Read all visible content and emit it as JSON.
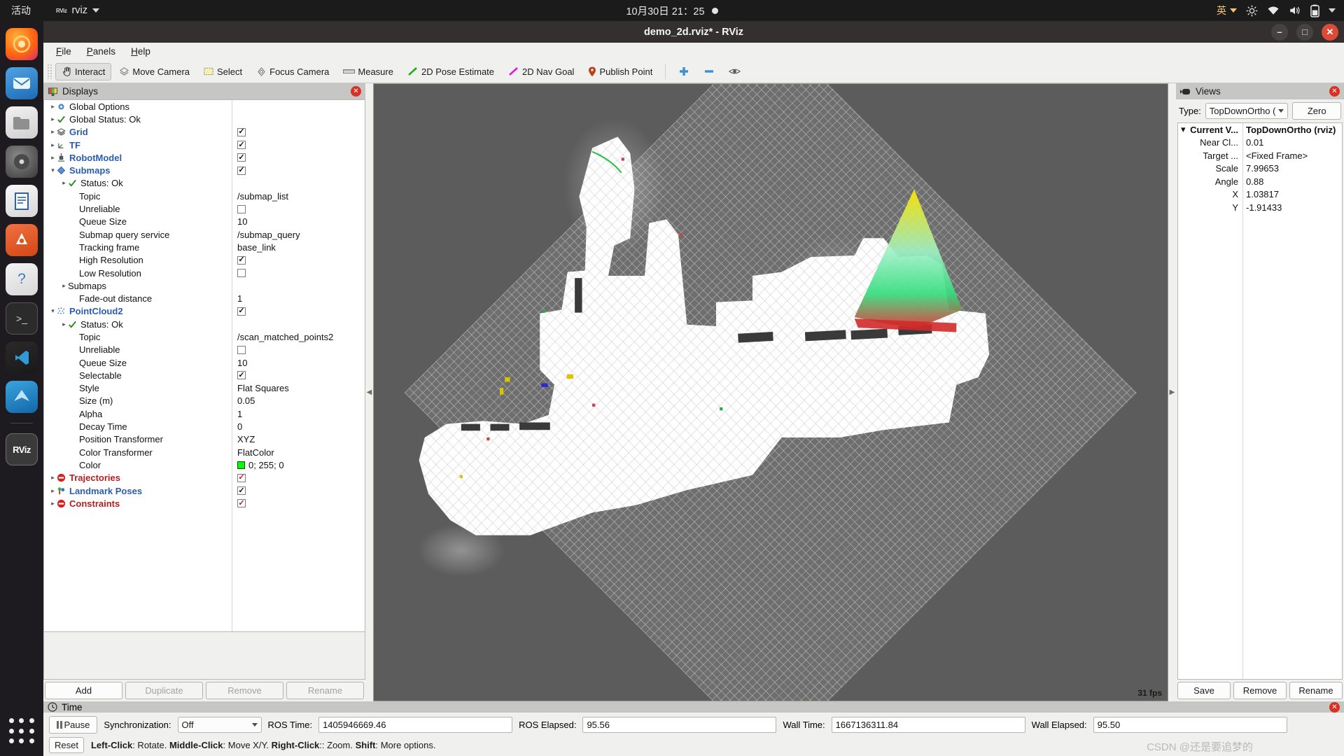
{
  "gnome": {
    "activities": "活动",
    "app_name": "rviz",
    "app_icon": "rviz-icon",
    "clock": "10月30日  21：25",
    "record_indicator": "record-dot",
    "ime": "英",
    "icons": [
      "brightness-icon",
      "wifi-icon",
      "volume-icon",
      "battery-icon",
      "chevron-down-icon"
    ]
  },
  "dock": {
    "items": [
      {
        "name": "firefox",
        "glyph": "●"
      },
      {
        "name": "thunderbird",
        "glyph": "✉"
      },
      {
        "name": "files",
        "glyph": "▰"
      },
      {
        "name": "rhythmbox",
        "glyph": "◉"
      },
      {
        "name": "libreoffice-writer",
        "glyph": "▤"
      },
      {
        "name": "ubuntu-software",
        "glyph": "A"
      },
      {
        "name": "help",
        "glyph": "?"
      },
      {
        "name": "terminal",
        "glyph": ">_"
      },
      {
        "name": "vscode",
        "glyph": "⬢"
      },
      {
        "name": "origami",
        "glyph": "◢"
      },
      {
        "name": "rviz",
        "glyph": "RViz"
      }
    ],
    "show_apps": "show-applications"
  },
  "window": {
    "title": "demo_2d.rviz* - RViz",
    "minimize": "–",
    "maximize": "□",
    "close": "✕"
  },
  "menubar": [
    {
      "label": "File",
      "mnemonic": "F"
    },
    {
      "label": "Panels",
      "mnemonic": "P"
    },
    {
      "label": "Help",
      "mnemonic": "H"
    }
  ],
  "toolbar": {
    "items": [
      {
        "label": "Interact",
        "icon": "hand-cursor-icon",
        "active": true
      },
      {
        "label": "Move Camera",
        "icon": "move-camera-icon",
        "active": false
      },
      {
        "label": "Select",
        "icon": "select-rect-icon",
        "active": false
      },
      {
        "label": "Focus Camera",
        "icon": "focus-camera-icon",
        "active": false
      },
      {
        "label": "Measure",
        "icon": "ruler-icon",
        "active": false
      },
      {
        "label": "2D Pose Estimate",
        "icon": "pose-arrow-green-icon",
        "active": false
      },
      {
        "label": "2D Nav Goal",
        "icon": "nav-arrow-magenta-icon",
        "active": false
      },
      {
        "label": "Publish Point",
        "icon": "map-pin-icon",
        "active": false
      }
    ],
    "extra_icons": [
      "plus-icon",
      "minus-icon",
      "eye-icon"
    ]
  },
  "displays": {
    "title": "Displays",
    "title_icon": "monitor-icon",
    "close": "✕",
    "rows": [
      {
        "indent": 0,
        "arrow": "▸",
        "icon": "gear-icon",
        "label": "Global Options",
        "style": "plain",
        "value_type": "none"
      },
      {
        "indent": 0,
        "arrow": "▸",
        "icon": "check-green-icon",
        "label": "Global Status: Ok",
        "style": "plain",
        "value_type": "none"
      },
      {
        "indent": 0,
        "arrow": "▸",
        "icon": "grid-icon",
        "label": "Grid",
        "style": "blue",
        "value_type": "checkbox",
        "checked": true
      },
      {
        "indent": 0,
        "arrow": "▸",
        "icon": "axes-icon",
        "label": "TF",
        "style": "blue",
        "value_type": "checkbox",
        "checked": true
      },
      {
        "indent": 0,
        "arrow": "▸",
        "icon": "robot-icon",
        "label": "RobotModel",
        "style": "blue",
        "value_type": "checkbox",
        "checked": true
      },
      {
        "indent": 0,
        "arrow": "▾",
        "icon": "submaps-icon",
        "label": "Submaps",
        "style": "blue",
        "value_type": "checkbox",
        "checked": true
      },
      {
        "indent": 1,
        "arrow": "▸",
        "icon": "check-green-icon",
        "label": "Status: Ok",
        "style": "plain",
        "value_type": "none"
      },
      {
        "indent": 2,
        "arrow": "",
        "icon": "",
        "label": "Topic",
        "style": "plain",
        "value_type": "text",
        "value": "/submap_list"
      },
      {
        "indent": 2,
        "arrow": "",
        "icon": "",
        "label": "Unreliable",
        "style": "plain",
        "value_type": "checkbox",
        "checked": false
      },
      {
        "indent": 2,
        "arrow": "",
        "icon": "",
        "label": "Queue Size",
        "style": "plain",
        "value_type": "text",
        "value": "10"
      },
      {
        "indent": 2,
        "arrow": "",
        "icon": "",
        "label": "Submap query service",
        "style": "plain",
        "value_type": "text",
        "value": "/submap_query"
      },
      {
        "indent": 2,
        "arrow": "",
        "icon": "",
        "label": "Tracking frame",
        "style": "plain",
        "value_type": "text",
        "value": "base_link"
      },
      {
        "indent": 2,
        "arrow": "",
        "icon": "",
        "label": "High Resolution",
        "style": "plain",
        "value_type": "checkbox",
        "checked": true
      },
      {
        "indent": 2,
        "arrow": "",
        "icon": "",
        "label": "Low Resolution",
        "style": "plain",
        "value_type": "checkbox",
        "checked": false
      },
      {
        "indent": 1,
        "arrow": "▸",
        "icon": "",
        "label": "Submaps",
        "style": "plain",
        "value_type": "none"
      },
      {
        "indent": 2,
        "arrow": "",
        "icon": "",
        "label": "Fade-out distance",
        "style": "plain",
        "value_type": "text",
        "value": "1"
      },
      {
        "indent": 0,
        "arrow": "▾",
        "icon": "pointcloud-icon",
        "label": "PointCloud2",
        "style": "blue",
        "value_type": "checkbox",
        "checked": true
      },
      {
        "indent": 1,
        "arrow": "▸",
        "icon": "check-green-icon",
        "label": "Status: Ok",
        "style": "plain",
        "value_type": "none"
      },
      {
        "indent": 2,
        "arrow": "",
        "icon": "",
        "label": "Topic",
        "style": "plain",
        "value_type": "text",
        "value": "/scan_matched_points2"
      },
      {
        "indent": 2,
        "arrow": "",
        "icon": "",
        "label": "Unreliable",
        "style": "plain",
        "value_type": "checkbox",
        "checked": false
      },
      {
        "indent": 2,
        "arrow": "",
        "icon": "",
        "label": "Queue Size",
        "style": "plain",
        "value_type": "text",
        "value": "10"
      },
      {
        "indent": 2,
        "arrow": "",
        "icon": "",
        "label": "Selectable",
        "style": "plain",
        "value_type": "checkbox",
        "checked": true
      },
      {
        "indent": 2,
        "arrow": "",
        "icon": "",
        "label": "Style",
        "style": "plain",
        "value_type": "text",
        "value": "Flat Squares"
      },
      {
        "indent": 2,
        "arrow": "",
        "icon": "",
        "label": "Size (m)",
        "style": "plain",
        "value_type": "text",
        "value": "0.05"
      },
      {
        "indent": 2,
        "arrow": "",
        "icon": "",
        "label": "Alpha",
        "style": "plain",
        "value_type": "text",
        "value": "1"
      },
      {
        "indent": 2,
        "arrow": "",
        "icon": "",
        "label": "Decay Time",
        "style": "plain",
        "value_type": "text",
        "value": "0"
      },
      {
        "indent": 2,
        "arrow": "",
        "icon": "",
        "label": "Position Transformer",
        "style": "plain",
        "value_type": "text",
        "value": "XYZ"
      },
      {
        "indent": 2,
        "arrow": "",
        "icon": "",
        "label": "Color Transformer",
        "style": "plain",
        "value_type": "text",
        "value": "FlatColor"
      },
      {
        "indent": 2,
        "arrow": "",
        "icon": "",
        "label": "Color",
        "style": "plain",
        "value_type": "color",
        "value": "0; 255; 0",
        "color": "#00ff00"
      },
      {
        "indent": 0,
        "arrow": "▸",
        "icon": "trajectories-icon",
        "label": "Trajectories",
        "style": "red",
        "value_type": "checkbox",
        "checked": true,
        "check_red": true
      },
      {
        "indent": 0,
        "arrow": "▸",
        "icon": "landmark-icon",
        "label": "Landmark Poses",
        "style": "blue",
        "value_type": "checkbox",
        "checked": true
      },
      {
        "indent": 0,
        "arrow": "▸",
        "icon": "constraints-icon",
        "label": "Constraints",
        "style": "red",
        "value_type": "checkbox",
        "checked": true,
        "check_red": true
      }
    ],
    "buttons": [
      {
        "label": "Add",
        "enabled": true
      },
      {
        "label": "Duplicate",
        "enabled": false
      },
      {
        "label": "Remove",
        "enabled": false
      },
      {
        "label": "Rename",
        "enabled": false
      }
    ]
  },
  "views": {
    "title": "Views",
    "title_icon": "camera-icon",
    "close": "✕",
    "type_label": "Type:",
    "type_value": "TopDownOrtho (",
    "zero_button": "Zero",
    "rows": [
      {
        "indent": 0,
        "arrow": "▾",
        "label": "Current V...",
        "value": "TopDownOrtho (rviz)",
        "bold": true
      },
      {
        "indent": 1,
        "arrow": "",
        "label": "Near Cl...",
        "value": "0.01",
        "bold": false
      },
      {
        "indent": 1,
        "arrow": "",
        "label": "Target ...",
        "value": "<Fixed Frame>",
        "bold": false
      },
      {
        "indent": 1,
        "arrow": "",
        "label": "Scale",
        "value": "7.99653",
        "bold": false
      },
      {
        "indent": 1,
        "arrow": "",
        "label": "Angle",
        "value": "0.88",
        "bold": false
      },
      {
        "indent": 1,
        "arrow": "",
        "label": "X",
        "value": "1.03817",
        "bold": false
      },
      {
        "indent": 1,
        "arrow": "",
        "label": "Y",
        "value": "-1.91433",
        "bold": false
      }
    ],
    "buttons": [
      {
        "label": "Save"
      },
      {
        "label": "Remove"
      },
      {
        "label": "Rename"
      }
    ]
  },
  "viewport": {
    "fps": "31 fps",
    "background_color": "#5c5c5c",
    "grid_color": "#bebebe"
  },
  "time": {
    "title": "Time",
    "title_icon": "clock-icon",
    "close": "✕",
    "pause_label": "Pause",
    "sync_label": "Synchronization:",
    "sync_value": "Off",
    "fields": [
      {
        "label": "ROS Time:",
        "value": "1405946669.46"
      },
      {
        "label": "ROS Elapsed:",
        "value": "95.56"
      },
      {
        "label": "Wall Time:",
        "value": "1667136311.84"
      },
      {
        "label": "Wall Elapsed:",
        "value": "95.50"
      }
    ],
    "reset_label": "Reset",
    "hint_parts": [
      {
        "text": "Left-Click",
        "bold": true
      },
      {
        "text": ": Rotate. ",
        "bold": false
      },
      {
        "text": "Middle-Click",
        "bold": true
      },
      {
        "text": ": Move X/Y. ",
        "bold": false
      },
      {
        "text": "Right-Click",
        "bold": true
      },
      {
        "text": ":: Zoom. ",
        "bold": false
      },
      {
        "text": "Shift",
        "bold": true
      },
      {
        "text": ": More options.",
        "bold": false
      }
    ],
    "watermark": "CSDN @还是要追梦的"
  }
}
